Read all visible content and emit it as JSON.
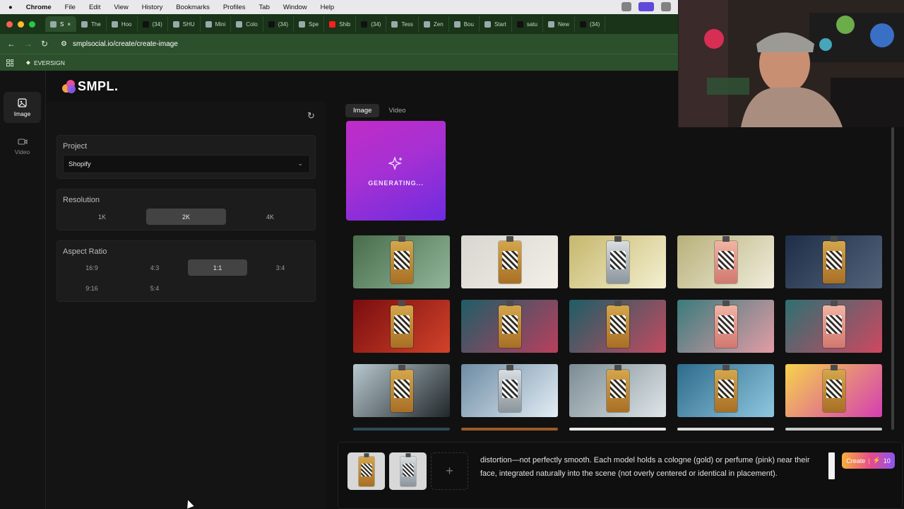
{
  "mac_menu": {
    "app": "Chrome",
    "items": [
      "File",
      "Edit",
      "View",
      "History",
      "Bookmarks",
      "Profiles",
      "Tab",
      "Window",
      "Help"
    ]
  },
  "browser": {
    "tabs": [
      {
        "label": "S",
        "icon": "page-icon",
        "active": true
      },
      {
        "label": "The",
        "icon": "page-icon"
      },
      {
        "label": "Hoo",
        "icon": "page-icon"
      },
      {
        "label": "(34)",
        "icon": "tiktok-icon"
      },
      {
        "label": "SHU",
        "icon": "page-icon"
      },
      {
        "label": "Mini",
        "icon": "page-icon"
      },
      {
        "label": "Colo",
        "icon": "page-icon"
      },
      {
        "label": "(34)",
        "icon": "tiktok-icon"
      },
      {
        "label": "Spe",
        "icon": "page-icon"
      },
      {
        "label": "Shib",
        "icon": "youtube-icon"
      },
      {
        "label": "(34)",
        "icon": "tiktok-icon"
      },
      {
        "label": "Tess",
        "icon": "page-icon"
      },
      {
        "label": "Zen",
        "icon": "page-icon"
      },
      {
        "label": "Bou",
        "icon": "page-icon"
      },
      {
        "label": "Start",
        "icon": "page-icon"
      },
      {
        "label": "satu",
        "icon": "tiktok-icon"
      },
      {
        "label": "New",
        "icon": "page-icon"
      },
      {
        "label": "(34)",
        "icon": "tiktok-icon"
      }
    ],
    "url": "smplsocial.io/create/create-image",
    "bookmark": "EVERSIGN"
  },
  "sidebar": {
    "image_label": "Image",
    "video_label": "Video"
  },
  "brand": {
    "name": "SMPL."
  },
  "settings": {
    "project_title": "Project",
    "project_value": "Shopify",
    "resolution_title": "Resolution",
    "resolutions": [
      "1K",
      "2K",
      "4K"
    ],
    "resolution_selected": "2K",
    "aspect_title": "Aspect Ratio",
    "aspects": [
      "16:9",
      "4:3",
      "1:1",
      "3:4",
      "9:16",
      "5:4"
    ],
    "aspect_selected": "1:1"
  },
  "media_tabs": {
    "image": "Image",
    "video": "Video"
  },
  "generating_label": "GENERATING...",
  "gallery": [
    {
      "scene": "models-jungle",
      "palette": [
        "#496d4b",
        "#90b69a"
      ],
      "bottle": "gold"
    },
    {
      "scene": "models-bottles",
      "palette": [
        "#d8d6d0",
        "#f3efe9"
      ],
      "bottle": "gold"
    },
    {
      "scene": "man-flowers",
      "palette": [
        "#c6b76c",
        "#f4f0d1"
      ],
      "bottle": "clear"
    },
    {
      "scene": "woman-flowers",
      "palette": [
        "#b8b07a",
        "#f0eddc"
      ],
      "bottle": "pink"
    },
    {
      "scene": "blue-room",
      "palette": [
        "#1f2e48",
        "#52637a"
      ],
      "bottle": "gold"
    },
    {
      "scene": "red-chains",
      "palette": [
        "#7a0d0f",
        "#d1432a"
      ],
      "bottle": "gold"
    },
    {
      "scene": "roses-teal",
      "palette": [
        "#1f5d67",
        "#b93f5e"
      ],
      "bottle": "gold"
    },
    {
      "scene": "roses-teal",
      "palette": [
        "#1d5e66",
        "#c44a60"
      ],
      "bottle": "gold"
    },
    {
      "scene": "petals-teal",
      "palette": [
        "#3a7b7c",
        "#e49ca6"
      ],
      "bottle": "pink"
    },
    {
      "scene": "roses-teal",
      "palette": [
        "#2d7072",
        "#cf4761"
      ],
      "bottle": "pink"
    },
    {
      "scene": "waves-chains",
      "palette": [
        "#b8c8cf",
        "#20272a"
      ],
      "bottle": "gold"
    },
    {
      "scene": "ice-blue",
      "palette": [
        "#6d8ca4",
        "#e3edf5"
      ],
      "bottle": "clear"
    },
    {
      "scene": "mist-waves",
      "palette": [
        "#7b8b93",
        "#dfe6e9"
      ],
      "bottle": "gold"
    },
    {
      "scene": "ocean-chains",
      "palette": [
        "#2e6b8b",
        "#8fc7df"
      ],
      "bottle": "gold"
    },
    {
      "scene": "rainbow-splash",
      "palette": [
        "#f7d34a",
        "#d53eb1"
      ],
      "bottle": "gold"
    }
  ],
  "prompt": {
    "text": "distortion—not perfectly smooth. Each model holds a cologne (gold) or perfume (pink) near their face, integrated naturally into the scene (not overly centered or identical in placement).",
    "refs": [
      "gold",
      "clear"
    ],
    "add_label": "+",
    "create_label": "Create",
    "create_cost": "10"
  },
  "colors": {
    "accent_start": "#f7b03a",
    "accent_mid": "#e64b8b",
    "accent_end": "#8a55f2",
    "browser_green": "#2c4f2c"
  }
}
